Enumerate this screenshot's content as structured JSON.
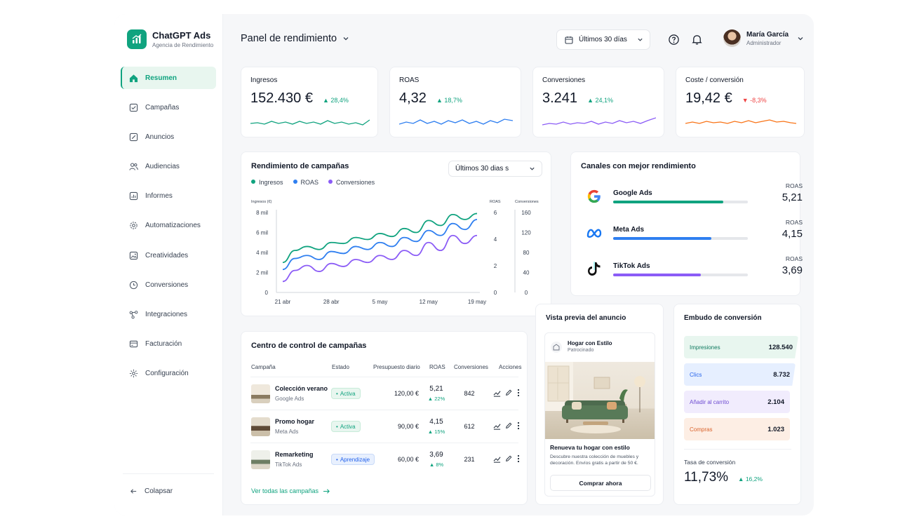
{
  "brand": {
    "name": "ChatGPT Ads",
    "subtitle": "Agencia de Rendimiento"
  },
  "colors": {
    "accent": "#10a37f",
    "blue": "#2f7ff0",
    "purple": "#8b5cf6",
    "orange": "#f97316",
    "negative": "#ef4444"
  },
  "sidebar": {
    "items": [
      {
        "label": "Resumen",
        "icon": "home-icon",
        "active": true
      },
      {
        "label": "Campañas",
        "icon": "checkbox-icon"
      },
      {
        "label": "Anuncios",
        "icon": "edit-square-icon"
      },
      {
        "label": "Audiencias",
        "icon": "users-icon"
      },
      {
        "label": "Informes",
        "icon": "bar-chart-icon"
      },
      {
        "label": "Automatizaciones",
        "icon": "cog-gear-icon"
      },
      {
        "label": "Creatividades",
        "icon": "image-icon"
      },
      {
        "label": "Conversiones",
        "icon": "target-icon"
      },
      {
        "label": "Integraciones",
        "icon": "nodes-icon"
      },
      {
        "label": "Facturación",
        "icon": "card-icon"
      },
      {
        "label": "Configuración",
        "icon": "settings-icon"
      }
    ],
    "collapse_label": "Colapsar"
  },
  "header": {
    "title": "Panel de rendimiento",
    "date_range": "Últimos 30 días",
    "user": {
      "name": "María García",
      "role": "Administrador"
    }
  },
  "kpis": [
    {
      "label": "Ingresos",
      "value": "152.430 €",
      "delta": "28,4%",
      "trend": "up",
      "color": "#10a37f"
    },
    {
      "label": "ROAS",
      "value": "4,32",
      "delta": "18,7%",
      "trend": "up",
      "color": "#2f7ff0"
    },
    {
      "label": "Conversiones",
      "value": "3.241",
      "delta": "24,1%",
      "trend": "up",
      "color": "#8b5cf6"
    },
    {
      "label": "Coste / conversión",
      "value": "19,42 €",
      "delta": "-8,3%",
      "trend": "down",
      "color": "#f97316"
    }
  ],
  "campaign_chart": {
    "title": "Rendimiento de campañas",
    "range_select": "Últimos 30 dias s"
  },
  "chart_data": {
    "type": "line",
    "title": "Rendimiento de campañas",
    "x": [
      "21 abr",
      "28 abr",
      "5 may",
      "12 may",
      "19 may"
    ],
    "series": [
      {
        "name": "Ingresos",
        "axis": "left",
        "color": "#10a37f",
        "values": [
          3000,
          4200,
          4600,
          4300,
          5000,
          4900,
          5500,
          5300,
          5900,
          5600,
          6400,
          6000,
          7200,
          6700,
          7800,
          7300,
          7900
        ]
      },
      {
        "name": "ROAS",
        "axis": "left",
        "color": "#2f7ff0",
        "values": [
          2300,
          3400,
          3700,
          3300,
          4100,
          3900,
          4600,
          4300,
          5000,
          4600,
          5500,
          5100,
          6200,
          5700,
          6900,
          6300,
          7300
        ]
      },
      {
        "name": "Conversiones",
        "axis": "left",
        "color": "#8b5cf6",
        "values": [
          1100,
          2200,
          2700,
          2100,
          2900,
          2600,
          3300,
          3000,
          3700,
          3300,
          4200,
          3700,
          5000,
          4200,
          5700,
          4900,
          5700
        ]
      }
    ],
    "axes": {
      "left": {
        "label": "Ingresos (€)",
        "ticks": [
          "0",
          "2 mil",
          "4 mil",
          "6 mil",
          "8 mil"
        ],
        "range": [
          0,
          8000
        ]
      },
      "right1": {
        "label": "ROAS",
        "ticks": [
          "0",
          "2",
          "4",
          "6"
        ],
        "range": [
          0,
          6
        ]
      },
      "right2": {
        "label": "Conversiones",
        "ticks": [
          "0",
          "40",
          "80",
          "120",
          "160"
        ],
        "range": [
          0,
          160
        ]
      }
    },
    "grid": false,
    "legend_position": "top-left"
  },
  "channels": {
    "title": "Canales con mejor rendimiento",
    "roas_label": "ROAS",
    "items": [
      {
        "name": "Google Ads",
        "roas": "5,21",
        "share": 0.82,
        "color": "#10a37f",
        "icon": "google-icon"
      },
      {
        "name": "Meta Ads",
        "roas": "4,15",
        "share": 0.73,
        "color": "#2f7ff0",
        "icon": "meta-icon"
      },
      {
        "name": "TikTok Ads",
        "roas": "3,69",
        "share": 0.65,
        "color": "#8b5cf6",
        "icon": "tiktok-icon"
      }
    ]
  },
  "campaign_table": {
    "title": "Centro de control de campañas",
    "columns": [
      "Campaña",
      "Estado",
      "Presupuesto diario",
      "ROAS",
      "Conversiones",
      "Acciones"
    ],
    "rows": [
      {
        "name": "Colección verano",
        "channel": "Google Ads",
        "status": "Activa",
        "status_color": "green",
        "budget": "120,00 €",
        "roas": "5,21",
        "roas_delta": "22%",
        "conversions": "842"
      },
      {
        "name": "Promo hogar",
        "channel": "Meta Ads",
        "status": "Activa",
        "status_color": "green",
        "budget": "90,00 €",
        "roas": "4,15",
        "roas_delta": "15%",
        "conversions": "612"
      },
      {
        "name": "Remarketing",
        "channel": "TikTok Ads",
        "status": "Aprendizaje",
        "status_color": "blue",
        "budget": "60,00 €",
        "roas": "3,69",
        "roas_delta": "8%",
        "conversions": "231"
      }
    ],
    "view_all": "Ver todas las campañas"
  },
  "ad_preview": {
    "title": "Vista previa del anuncio",
    "brand": "Hogar con Estilo",
    "sponsored": "Patrocinado",
    "headline": "Renueva tu hogar con estilo",
    "body": "Descubre nuestra colección de muebles y decoración. Envíos gratis a partir de 50 €.",
    "cta": "Comprar ahora"
  },
  "funnel": {
    "title": "Embudo de conversión",
    "steps": [
      {
        "label": "Impresiones",
        "value": "128.540",
        "color": "#e8f6ef",
        "text": "#0f7a5f"
      },
      {
        "label": "Clics",
        "value": "8.732",
        "color": "#e6efff",
        "text": "#2563eb"
      },
      {
        "label": "Añadir al carrito",
        "value": "2.104",
        "color": "#f1ecfd",
        "text": "#6d4bd1"
      },
      {
        "label": "Compras",
        "value": "1.023",
        "color": "#fdeee4",
        "text": "#d9622b"
      }
    ],
    "rate_label": "Tasa de conversión",
    "rate_value": "11,73%",
    "rate_delta": "16,2%"
  }
}
